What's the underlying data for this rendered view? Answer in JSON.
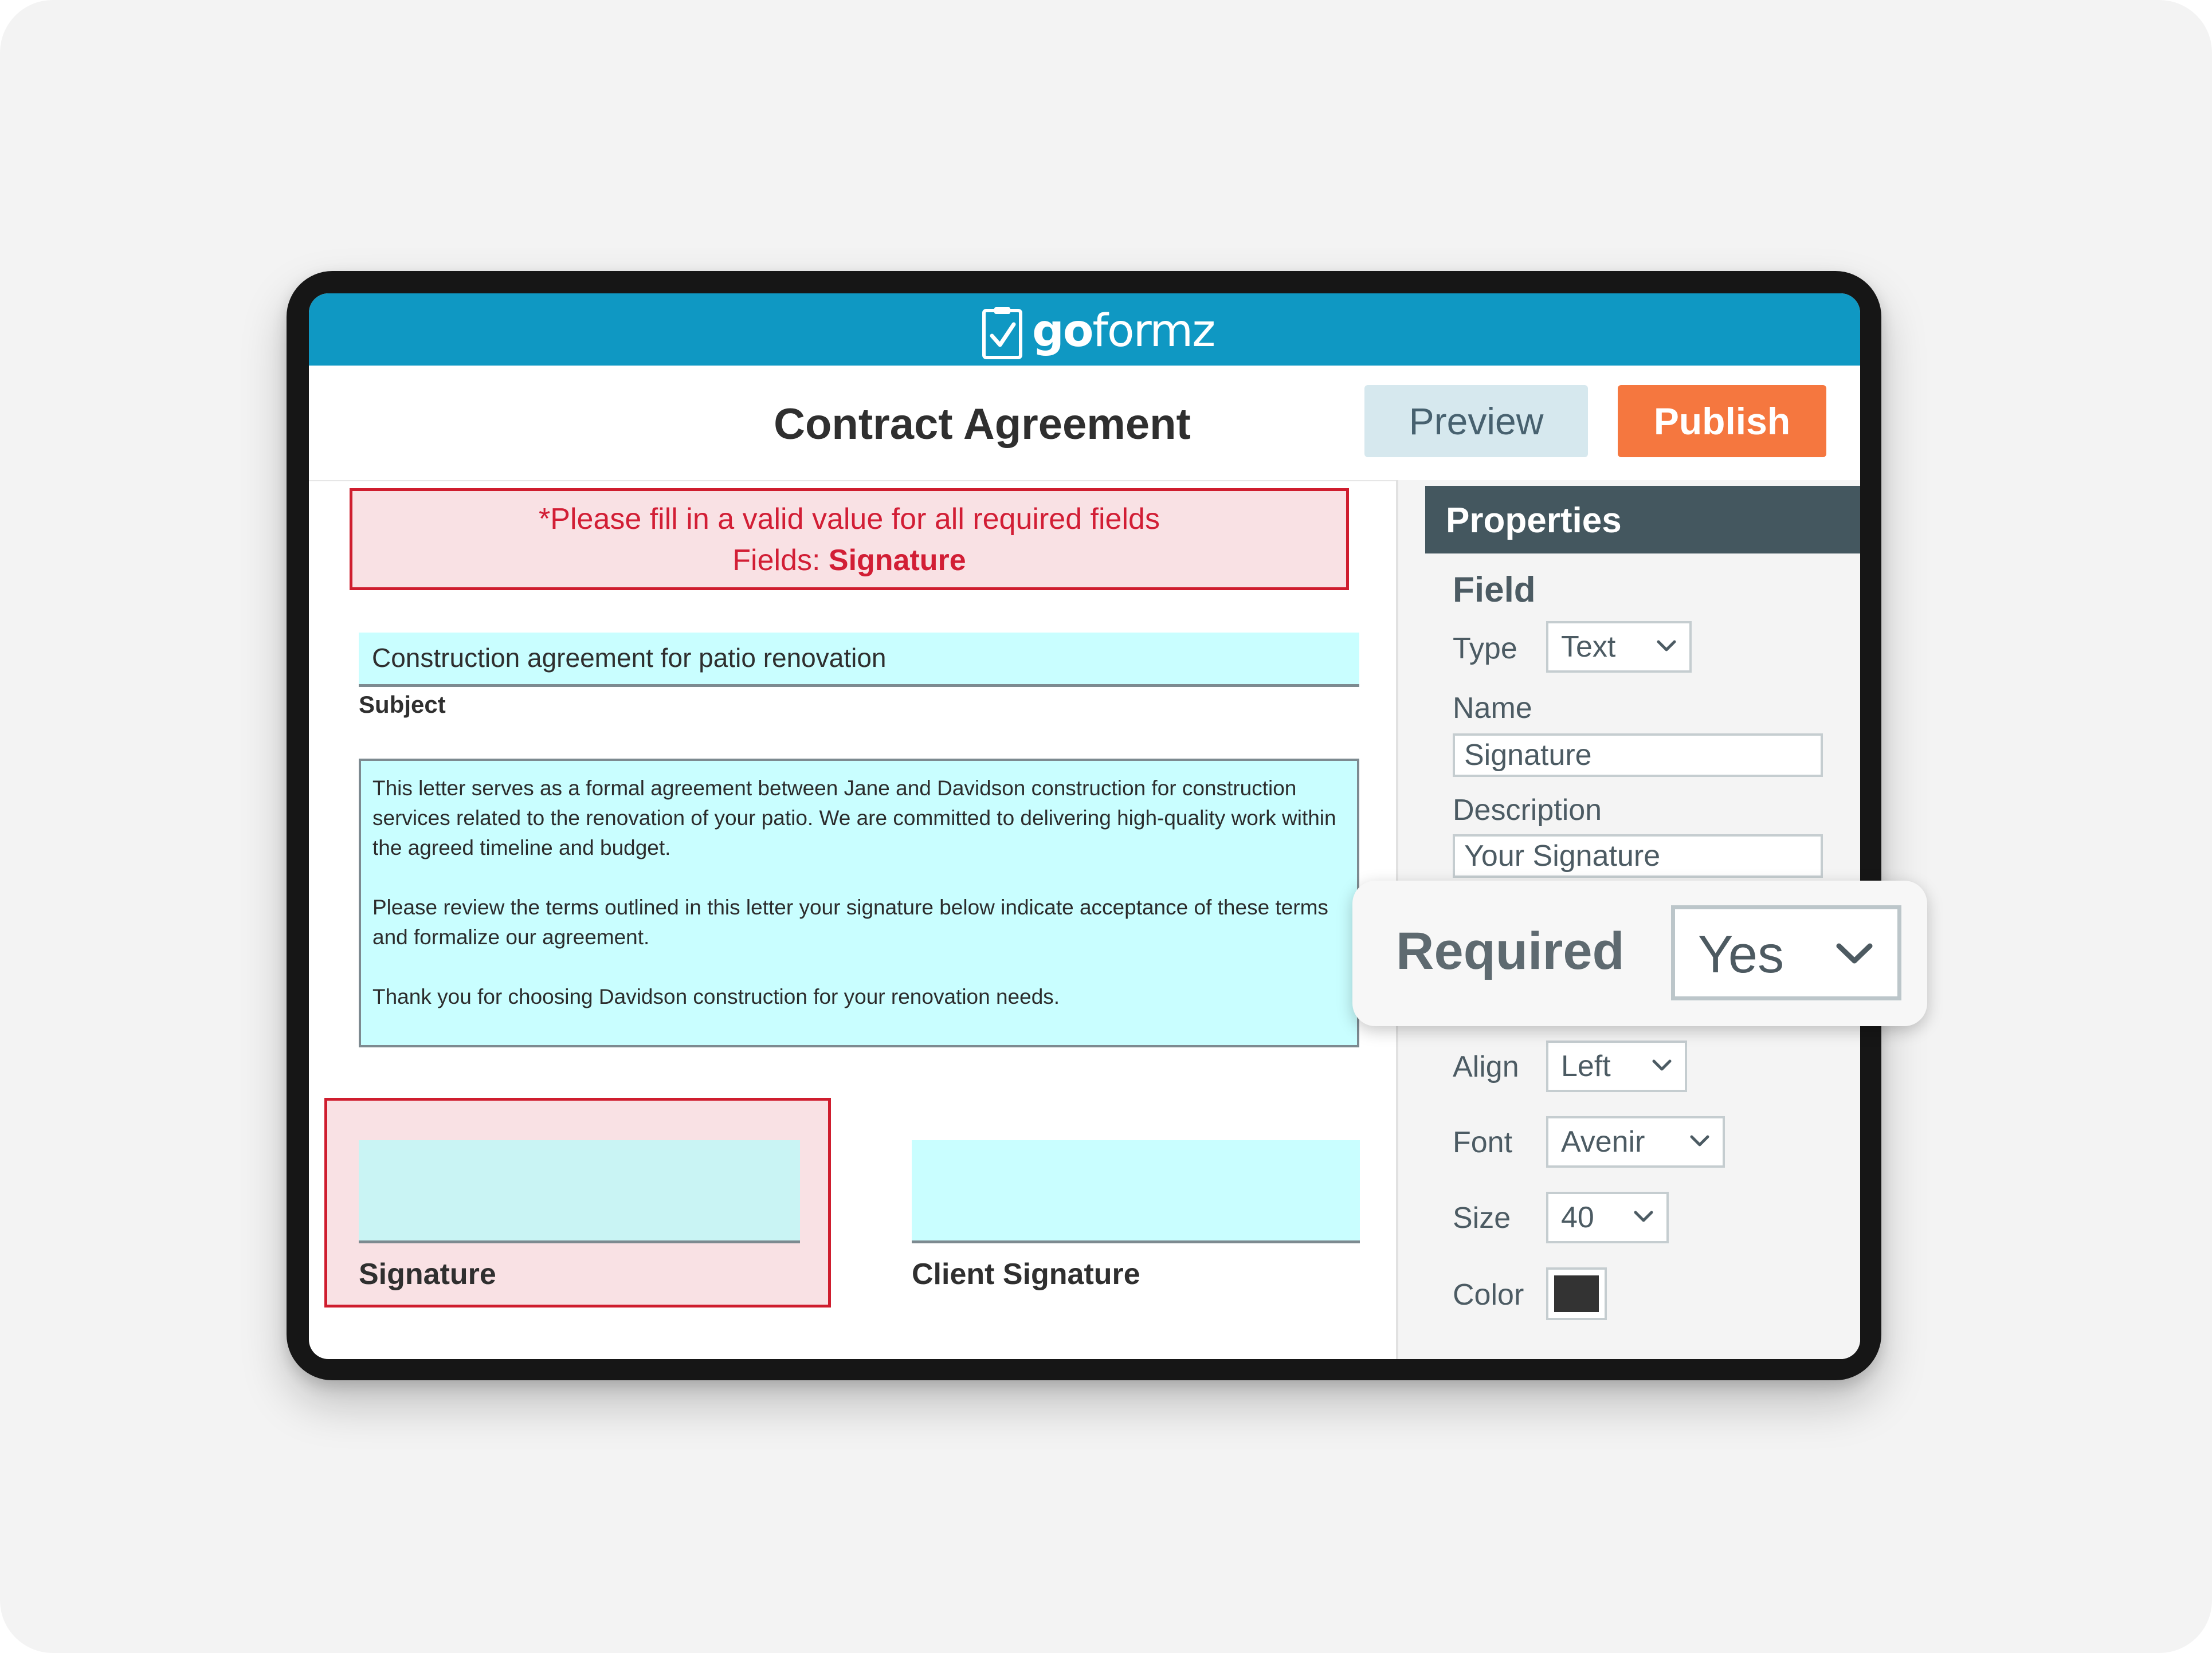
{
  "app": {
    "logo_text_bold": "go",
    "logo_text_regular": "formz",
    "brand_color": "#0f98c3",
    "accent_color": "#f5773f"
  },
  "header": {
    "title": "Contract Agreement",
    "preview_label": "Preview",
    "publish_label": "Publish"
  },
  "form": {
    "error": {
      "line1": "*Please fill in a valid value for all required fields",
      "line2_prefix": "Fields: ",
      "line2_field": "Signature",
      "color": "#d21e35"
    },
    "subject": {
      "value": "Construction agreement for patio renovation",
      "label": "Subject"
    },
    "body": {
      "paragraphs": [
        "This letter serves as a formal agreement between Jane and Davidson construction for construction services related to the renovation of your patio. We are committed to delivering high-quality work within the agreed timeline and budget.",
        "Please review the terms outlined in this letter your signature below indicate acceptance of these terms and formalize our agreement.",
        "Thank you for choosing Davidson construction for your renovation needs."
      ]
    },
    "signature_label": "Signature",
    "client_signature_label": "Client Signature"
  },
  "properties": {
    "header": "Properties",
    "section": "Field",
    "type_label": "Type",
    "type_value": "Text",
    "name_label": "Name",
    "name_value": "Signature",
    "description_label": "Description",
    "description_value": "Your Signature",
    "required_label": "Required",
    "required_value": "Yes",
    "align_label": "Align",
    "align_value": "Left",
    "font_label": "Font",
    "font_value": "Avenir",
    "size_label": "Size",
    "size_value": "40",
    "color_label": "Color",
    "color_value": "#333333"
  },
  "icons": [
    "form-logo-icon",
    "chevron-down-icon"
  ]
}
